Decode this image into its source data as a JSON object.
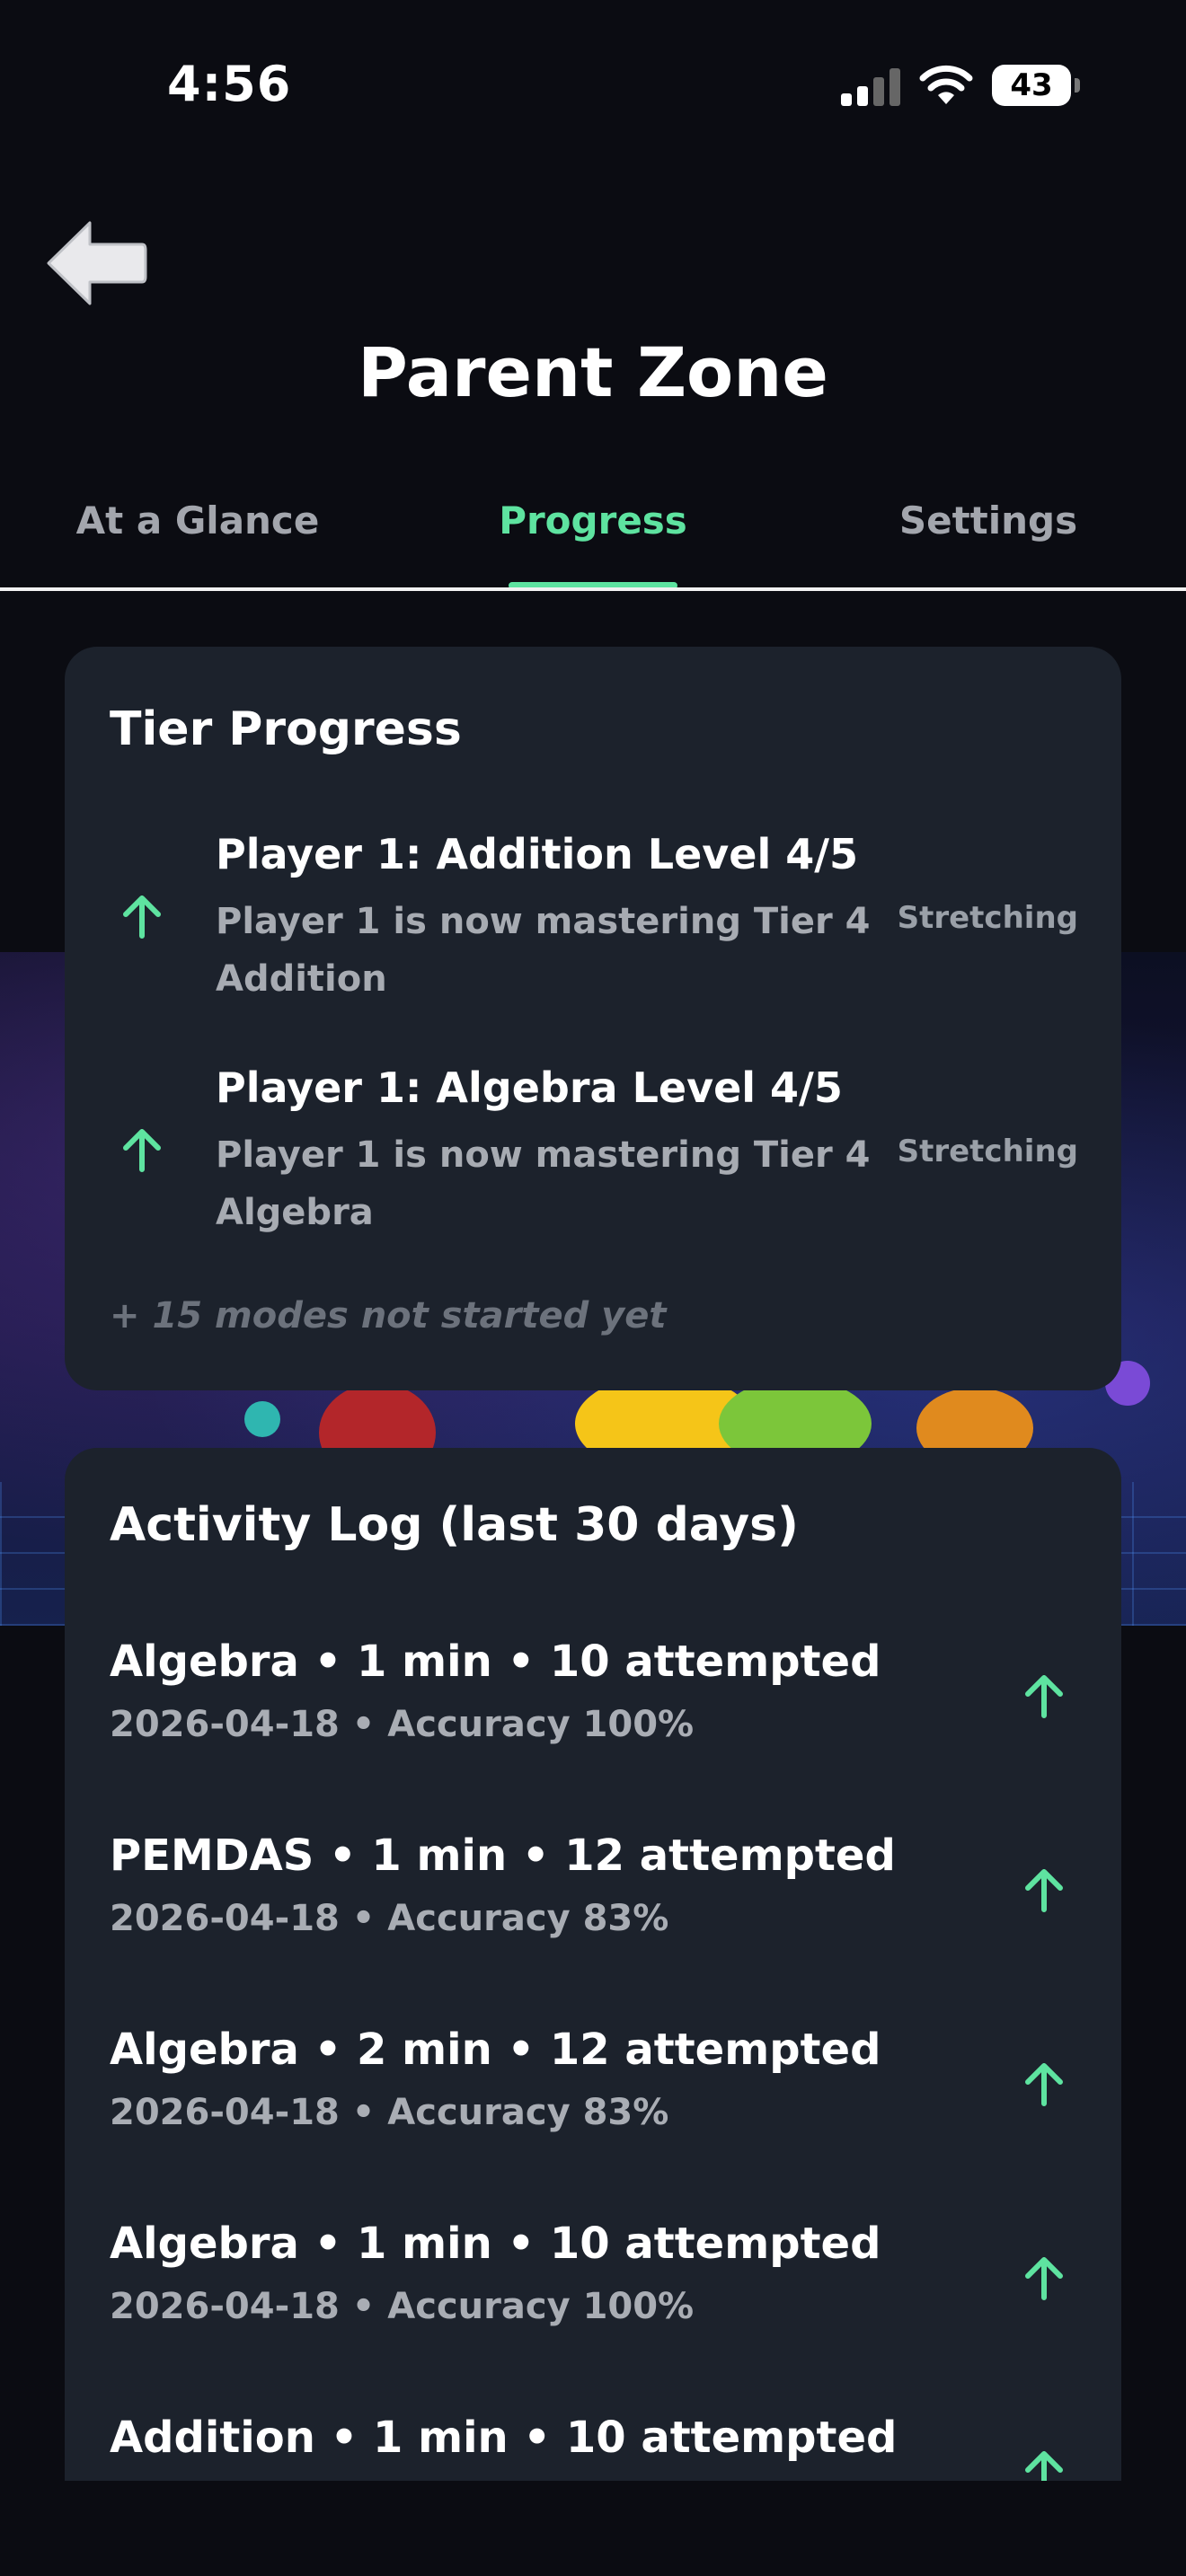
{
  "status_bar": {
    "time": "4:56",
    "battery": "43"
  },
  "header": {
    "title": "Parent Zone"
  },
  "tabs": [
    {
      "label": "At a Glance",
      "active": false
    },
    {
      "label": "Progress",
      "active": true
    },
    {
      "label": "Settings",
      "active": false
    }
  ],
  "tier_progress": {
    "title": "Tier Progress",
    "items": [
      {
        "title": "Player 1: Addition Level 4/5",
        "desc_line1": "Player 1 is now mastering Tier 4",
        "desc_line2": "Addition",
        "badge": "Stretching",
        "icon": "arrow-up-icon"
      },
      {
        "title": "Player 1: Algebra Level 4/5",
        "desc_line1": "Player 1 is now mastering Tier 4",
        "desc_line2": "Algebra",
        "badge": "Stretching",
        "icon": "arrow-up-icon"
      }
    ],
    "footer": "+ 15 modes not started yet"
  },
  "activity_log": {
    "title": "Activity Log (last 30 days)",
    "entries": [
      {
        "title": "Algebra • 1 min • 10 attempted",
        "sub": "2026-04-18 • Accuracy 100%"
      },
      {
        "title": "PEMDAS • 1 min • 12 attempted",
        "sub": "2026-04-18 • Accuracy 83%"
      },
      {
        "title": "Algebra • 2 min • 12 attempted",
        "sub": "2026-04-18 • Accuracy 83%"
      },
      {
        "title": "Algebra • 1 min • 10 attempted",
        "sub": "2026-04-18 • Accuracy 100%"
      },
      {
        "title": "Addition • 1 min • 10 attempted",
        "sub": ""
      }
    ]
  },
  "colors": {
    "accent": "#5ee3a0",
    "card": "#1c222c",
    "background": "#0b0c12"
  }
}
